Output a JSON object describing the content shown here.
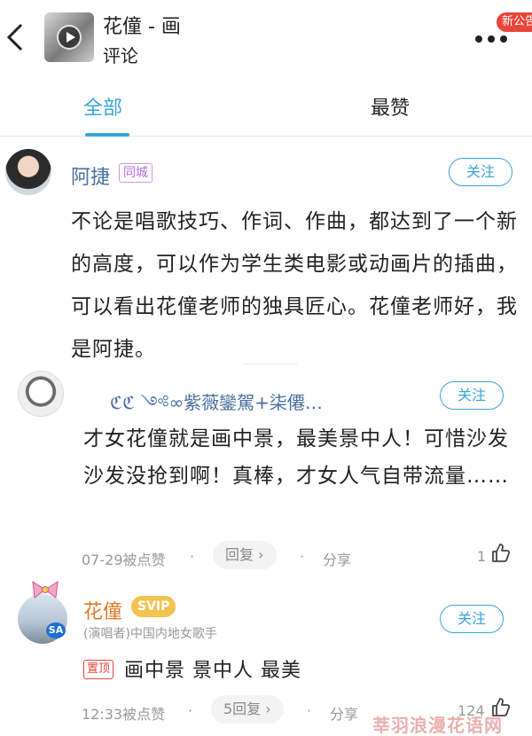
{
  "header": {
    "song_title": "花僮 - 画",
    "subtitle": "评论",
    "new_notice": "新公告"
  },
  "tabs": [
    {
      "label": "全部",
      "active": true
    },
    {
      "label": "最赞",
      "active": false
    }
  ],
  "accent_color": "#3aa5d8",
  "comments": [
    {
      "user": "阿捷",
      "tag": "同城",
      "follow_label": "关注",
      "text": "不论是唱歌技巧、作词、作曲，都达到了一个新的高度，可以作为学生类电影或动画片的插曲，可以看出花僮老师的独具匠心。花僮老师好，我是阿捷。"
    },
    {
      "user": "ℭℭ ༺∞紫薇鑾駕+柒僊…",
      "follow_label": "关注",
      "text": "才女花僮就是画中景，最美景中人！可惜沙发沙发没抢到啊！真棒，才女人气自带流量……",
      "date": "07-29被点赞",
      "reply_label": "回复",
      "share_label": "分享",
      "likes": "1"
    },
    {
      "user": "花僮",
      "vip_badge": "SVIP",
      "role": "(演唱者)中国内地女歌手",
      "follow_label": "关注",
      "pin_label": "置顶",
      "avatar_badge": "SA",
      "text": "画中景 景中人 最美",
      "date": "12:33被点赞",
      "reply_label": "5回复",
      "share_label": "分享",
      "likes": "124"
    }
  ],
  "watermark": "莘羽浪漫花语网"
}
